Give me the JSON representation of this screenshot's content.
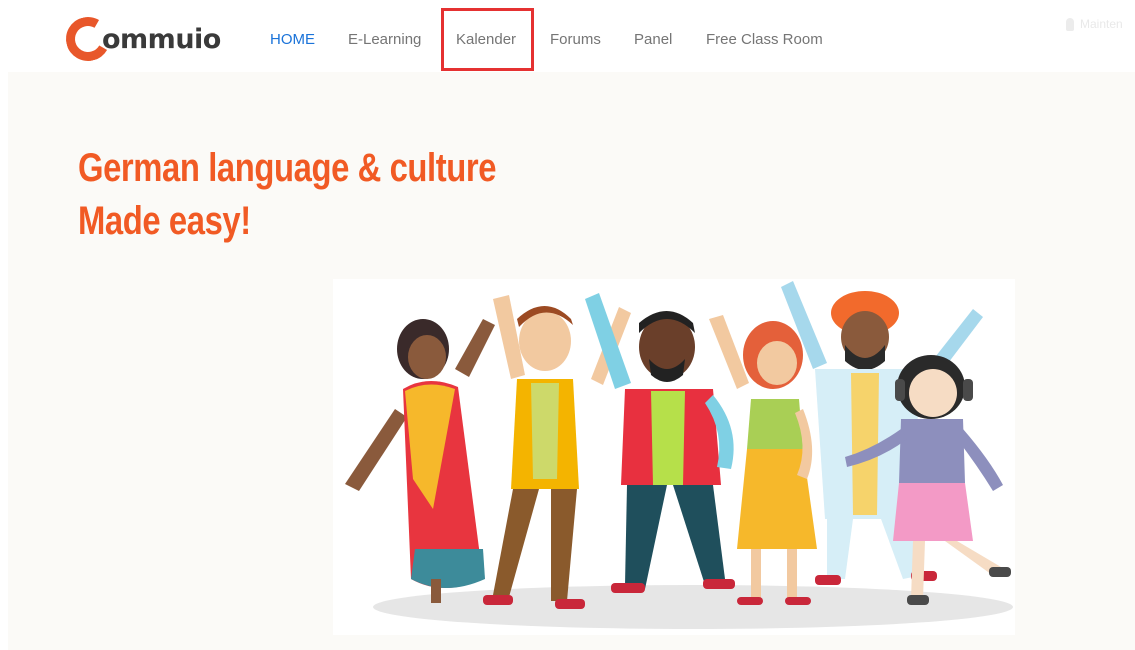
{
  "brand": {
    "logo_text": "ommuio"
  },
  "nav": {
    "items": [
      {
        "label": "HOME",
        "active": true
      },
      {
        "label": "E-Learning",
        "active": false
      },
      {
        "label": "Kalender",
        "active": false,
        "highlighted": true
      },
      {
        "label": "Forums",
        "active": false
      },
      {
        "label": "Panel",
        "active": false
      },
      {
        "label": "Free Class Room",
        "active": false
      }
    ],
    "maintenance_label": "Mainten",
    "maintenance_icon": "microphone-icon"
  },
  "hero": {
    "line1": "German language & culture",
    "line2": "Made easy!",
    "image": "group-of-diverse-people-dancing-illustration"
  },
  "colors": {
    "brand_orange": "#f15a24",
    "nav_active": "#1a73d9",
    "highlight_box": "#e53131"
  }
}
